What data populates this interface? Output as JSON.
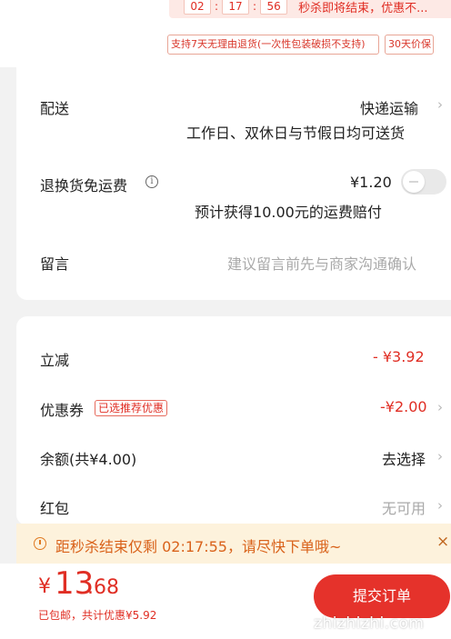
{
  "top": {
    "countdown": {
      "hours": "02",
      "minutes": "17",
      "seconds": "56",
      "text": "秒杀即将结束，优惠不..."
    },
    "tags": {
      "return": "支持7天无理由退货(一次性包装破损不支持)",
      "price_protect": "30天价保"
    }
  },
  "delivery": {
    "label": "配送",
    "value": "快递运输",
    "sub": "工作日、双休日与节假日均可送货"
  },
  "return_fee": {
    "label": "退换货免运费",
    "info_icon": "i",
    "price": "¥1.20",
    "sub_prefix": "预计获得",
    "sub_amount": "10.00",
    "sub_suffix": "元的运费赔付"
  },
  "message": {
    "label": "留言",
    "placeholder": "建议留言前先与商家沟通确认"
  },
  "discounts": {
    "instant": {
      "label": "立减",
      "value": "- ¥3.92"
    },
    "coupon": {
      "label": "优惠券",
      "badge": "已选推荐优惠",
      "value": "-¥2.00"
    },
    "balance": {
      "label": "余额(共¥4.00)",
      "value": "去选择"
    },
    "red_packet": {
      "label": "红包",
      "value": "无可用"
    }
  },
  "banner": {
    "text": "距秒杀结束仅剩 02:17:55，请尽快下单哦~",
    "close": "×"
  },
  "footer": {
    "price_symbol": "¥",
    "price_int": "13",
    "price_dec": ".68",
    "note_free_shipping": "已包邮",
    "note_total": "，共计优惠¥5.92",
    "pay_button": "提交订单",
    "watermark": "zhizhizhi.com"
  },
  "icons": {
    "chevron": "›",
    "info": "info-icon",
    "clock": "clock-icon",
    "close": "close-icon"
  },
  "colors": {
    "accent": "#e02e24",
    "banner_bg": "#fdf2dc",
    "banner_text": "#d9621a"
  }
}
